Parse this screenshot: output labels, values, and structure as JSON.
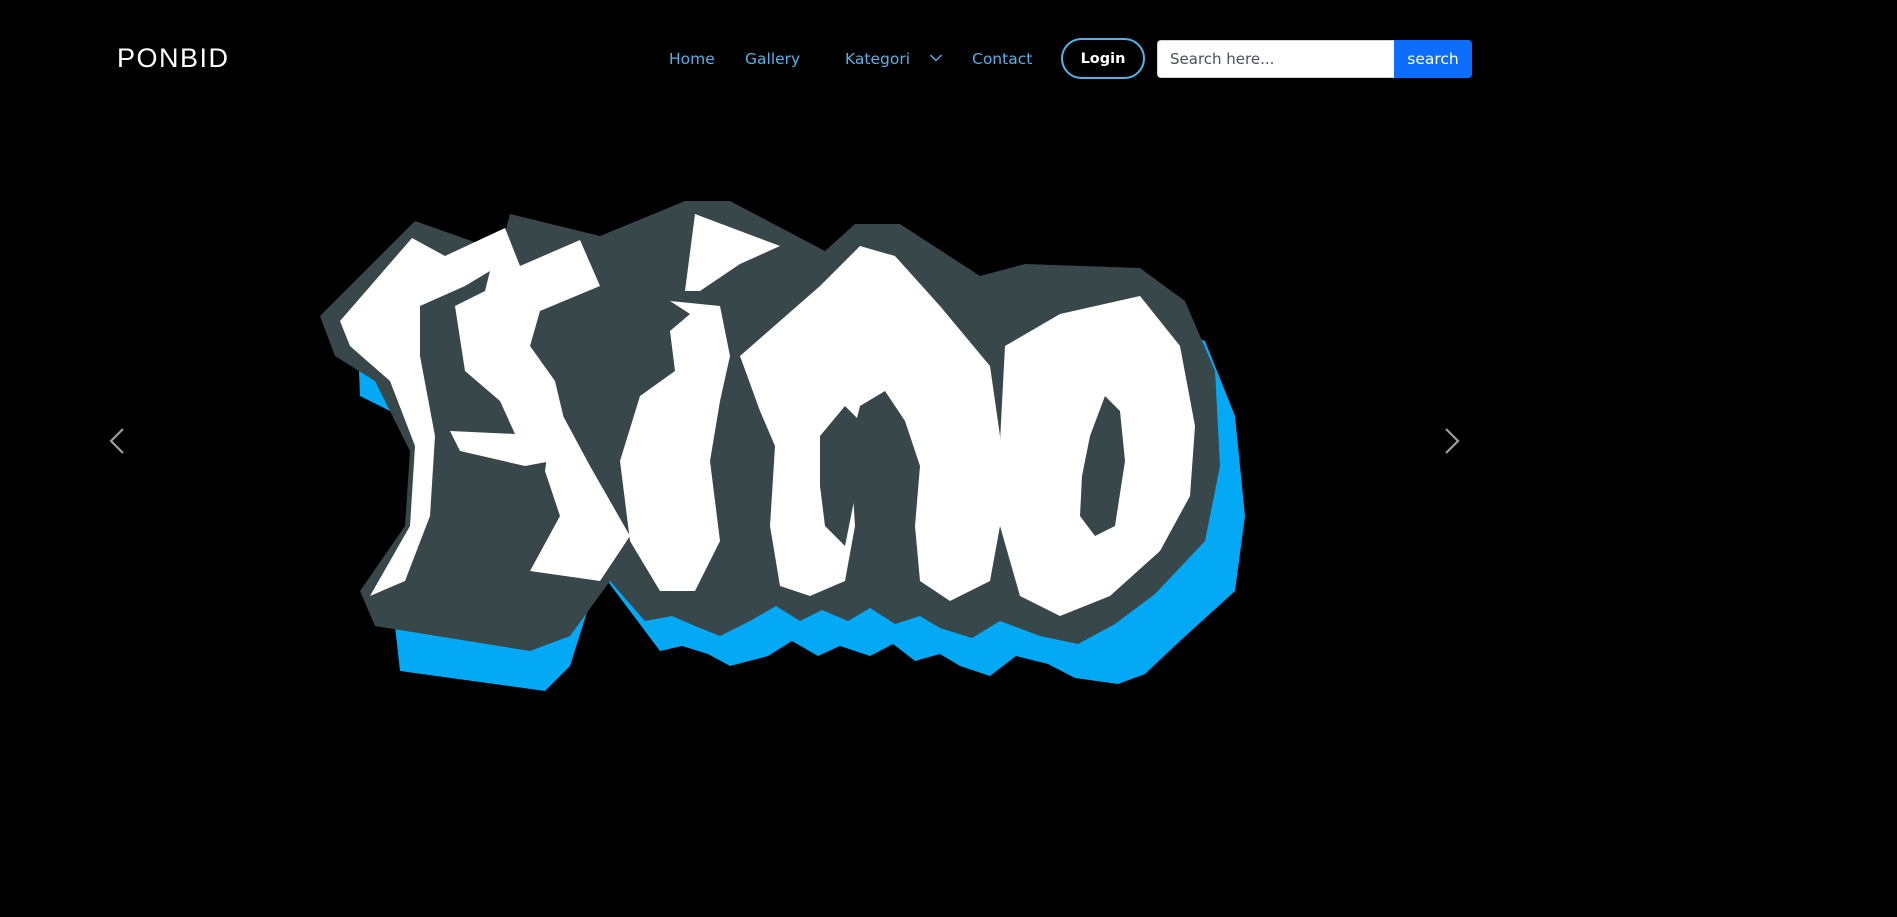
{
  "header": {
    "brand": "PONBID",
    "nav": {
      "home": "Home",
      "gallery": "Gallery",
      "kategori": "Kategori",
      "contact": "Contact"
    },
    "login_label": "Login",
    "search": {
      "placeholder": "Search here...",
      "value": "",
      "button_label": "search"
    }
  },
  "hero": {
    "logo_text": "Kino",
    "controls": {
      "prev_icon": "chevron-left-icon",
      "next_icon": "chevron-right-icon"
    }
  },
  "colors": {
    "background": "#000000",
    "nav_link": "#54b2e7",
    "search_button": "#0d6efd",
    "logo_fill": "#ffffff",
    "logo_outline": "#37474a",
    "logo_shadow": "#03a9f4"
  }
}
